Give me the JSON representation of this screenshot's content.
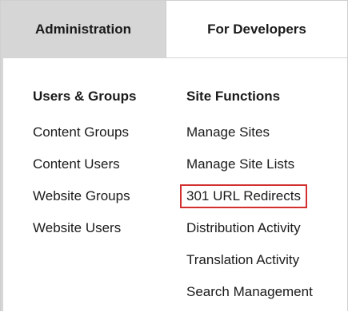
{
  "tabs": [
    {
      "label": "Administration",
      "active": true
    },
    {
      "label": "For Developers",
      "active": false
    }
  ],
  "columns": {
    "left": {
      "heading": "Users & Groups",
      "items": [
        "Content Groups",
        "Content Users",
        "Website Groups",
        "Website Users"
      ]
    },
    "right": {
      "heading": "Site Functions",
      "items": [
        "Manage Sites",
        "Manage Site Lists",
        "301 URL Redirects",
        "Distribution Activity",
        "Translation Activity",
        "Search Management"
      ],
      "highlighted_item": "301 URL Redirects"
    }
  },
  "colors": {
    "active_tab_bg": "#d6d6d6",
    "highlight_border": "#d32f2f",
    "text": "#1a1a1a"
  }
}
